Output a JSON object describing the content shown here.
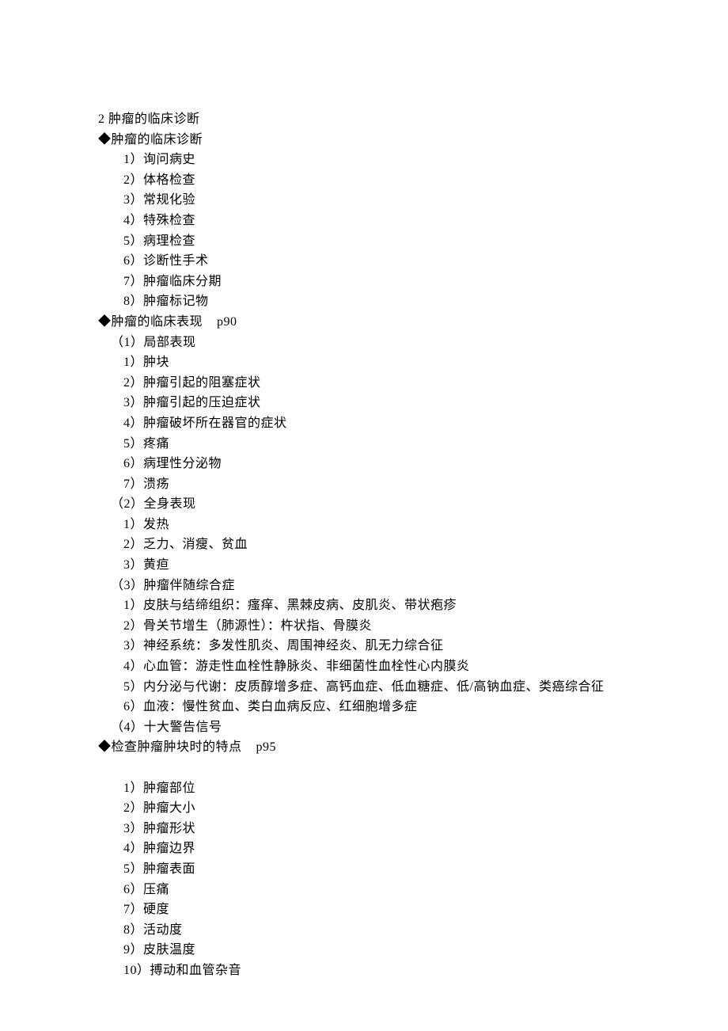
{
  "lines": [
    {
      "text": "2 肿瘤的临床诊断",
      "cls": "section-title"
    },
    {
      "text": "◆肿瘤的临床诊断",
      "cls": "bullet-title"
    },
    {
      "text": "1）询问病史",
      "cls": "sub-item"
    },
    {
      "text": "2）体格检查",
      "cls": "sub-item"
    },
    {
      "text": "3）常规化验",
      "cls": "sub-item"
    },
    {
      "text": "4）特殊检查",
      "cls": "sub-item"
    },
    {
      "text": "5）病理检查",
      "cls": "sub-item"
    },
    {
      "text": "6）诊断性手术",
      "cls": "sub-item"
    },
    {
      "text": "7）肿瘤临床分期",
      "cls": "sub-item"
    },
    {
      "text": "8）肿瘤标记物",
      "cls": "sub-item"
    },
    {
      "text": "◆肿瘤的临床表现    p90",
      "cls": "bullet-title"
    },
    {
      "text": "（1）局部表现",
      "cls": "paren-item"
    },
    {
      "text": "1）肿块",
      "cls": "sub-item"
    },
    {
      "text": "2）肿瘤引起的阻塞症状",
      "cls": "sub-item"
    },
    {
      "text": "3）肿瘤引起的压迫症状",
      "cls": "sub-item"
    },
    {
      "text": "4）肿瘤破坏所在器官的症状",
      "cls": "sub-item"
    },
    {
      "text": "5）疼痛",
      "cls": "sub-item"
    },
    {
      "text": "6）病理性分泌物",
      "cls": "sub-item"
    },
    {
      "text": "7）溃疡",
      "cls": "sub-item"
    },
    {
      "text": "（2）全身表现",
      "cls": "paren-item"
    },
    {
      "text": "1）发热",
      "cls": "sub-item"
    },
    {
      "text": "2）乏力、消瘦、贫血",
      "cls": "sub-item"
    },
    {
      "text": "3）黄疸",
      "cls": "sub-item"
    },
    {
      "text": "（3）肿瘤伴随综合症",
      "cls": "paren-item"
    },
    {
      "text": "1）皮肤与结缔组织：瘙痒、黑棘皮病、皮肌炎、带状疱疹",
      "cls": "sub-item"
    },
    {
      "text": "2）骨关节增生（肺源性）：杵状指、骨膜炎",
      "cls": "sub-item"
    },
    {
      "text": "3）神经系统：多发性肌炎、周围神经炎、肌无力综合征",
      "cls": "sub-item"
    },
    {
      "text": "4）心血管：游走性血栓性静脉炎、非细菌性血栓性心内膜炎",
      "cls": "sub-item"
    },
    {
      "text": "5）内分泌与代谢：皮质醇增多症、高钙血症、低血糖症、低/高钠血症、类癌综合征",
      "cls": "sub-item"
    },
    {
      "text": "6）血液：慢性贫血、类白血病反应、红细胞增多症",
      "cls": "sub-item"
    },
    {
      "text": "（4）十大警告信号",
      "cls": "paren-item"
    },
    {
      "text": "◆检查肿瘤肿块时的特点    p95",
      "cls": "bullet-title"
    },
    {
      "text": " ",
      "cls": "sub-item"
    },
    {
      "text": "1）肿瘤部位",
      "cls": "sub-item"
    },
    {
      "text": "2）肿瘤大小",
      "cls": "sub-item"
    },
    {
      "text": "3）肿瘤形状",
      "cls": "sub-item"
    },
    {
      "text": "4）肿瘤边界",
      "cls": "sub-item"
    },
    {
      "text": "5）肿瘤表面",
      "cls": "sub-item"
    },
    {
      "text": "6）压痛",
      "cls": "sub-item"
    },
    {
      "text": "7）硬度",
      "cls": "sub-item"
    },
    {
      "text": "8）活动度",
      "cls": "sub-item"
    },
    {
      "text": "9）皮肤温度",
      "cls": "sub-item"
    },
    {
      "text": "10）搏动和血管杂音",
      "cls": "sub-item"
    }
  ]
}
